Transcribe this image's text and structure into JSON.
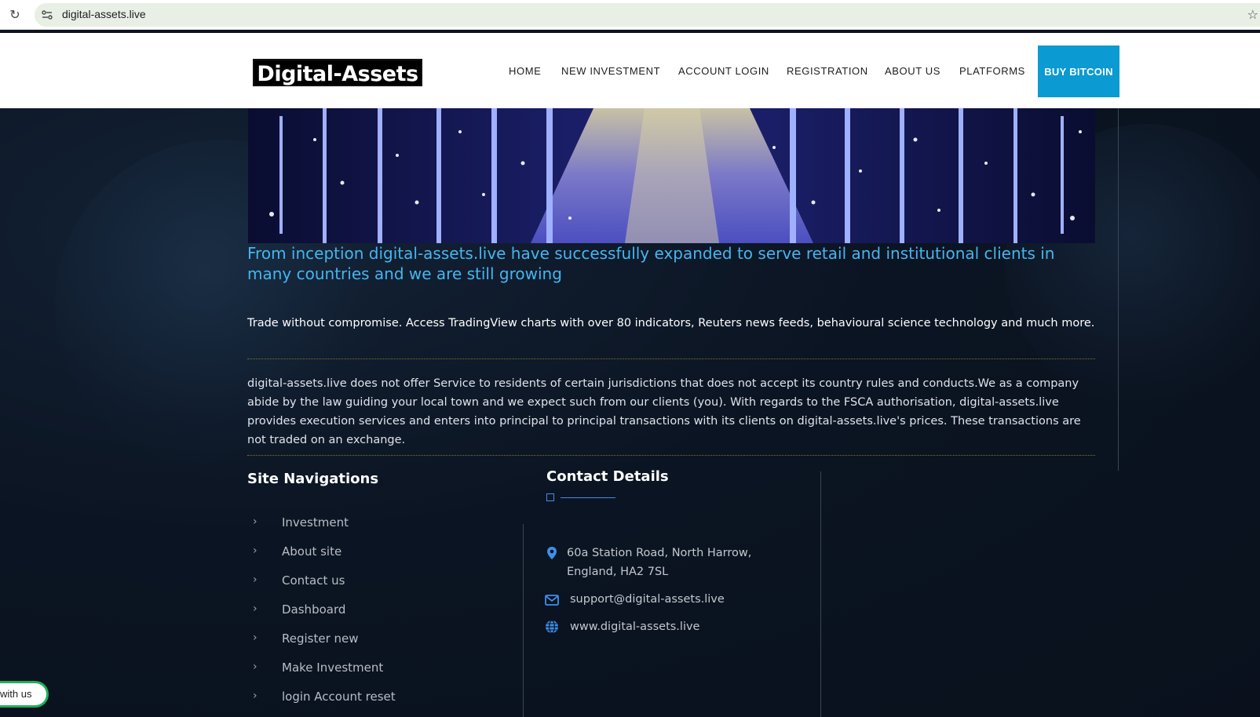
{
  "browser": {
    "url": "digital-assets.live"
  },
  "header": {
    "logo_text": "Digital-Assets",
    "nav": [
      {
        "label": "HOME"
      },
      {
        "label": "NEW INVESTMENT"
      },
      {
        "label": "ACCOUNT LOGIN"
      },
      {
        "label": "REGISTRATION"
      },
      {
        "label": "ABOUT US"
      },
      {
        "label": "PLATFORMS"
      }
    ],
    "cta_label": "BUY BITCOIN"
  },
  "content": {
    "lead": "From inception digital-assets.live have successfully expanded to serve retail and institutional clients in many countries and we are still growing",
    "trade_text": "Trade without compromise. Access TradingView charts with over 80 indicators, Reuters news feeds, behavioural science technology and much more.",
    "disclaimer": "digital-assets.live does not offer Service to residents of certain jurisdictions that does not accept its country rules and conducts.We as a company abide by the law guiding your local town and we expect such from our clients (you). With regards to the FSCA authorisation, digital-assets.live provides execution services and enters into principal to principal transactions with its clients on digital-assets.live's prices. These transactions are not traded on an exchange."
  },
  "footer": {
    "site_nav_title": "Site Navigations",
    "site_nav": [
      {
        "label": "Investment"
      },
      {
        "label": "About site"
      },
      {
        "label": "Contact us"
      },
      {
        "label": "Dashboard"
      },
      {
        "label": "Register new"
      },
      {
        "label": "Make Investment"
      },
      {
        "label": "login Account reset"
      }
    ],
    "contact_title": "Contact Details",
    "address_line1": "60a Station Road, North Harrow,",
    "address_line2": "England, HA2 7SL",
    "email": "support@digital-assets.live",
    "website": "www.digital-assets.live"
  },
  "chat_widget": {
    "label": "with us"
  },
  "colors": {
    "accent": "#0b9ad2",
    "lead_text": "#45b5f0",
    "background": "#0b1220",
    "icon_blue": "#3f8ee8"
  },
  "icons": {
    "reload": "reload-icon",
    "site_info": "site-settings-icon",
    "bookmark": "star-icon",
    "nav_chevron": "chevron-right-icon",
    "address": "map-pin-icon",
    "email": "envelope-icon",
    "website": "globe-icon"
  }
}
